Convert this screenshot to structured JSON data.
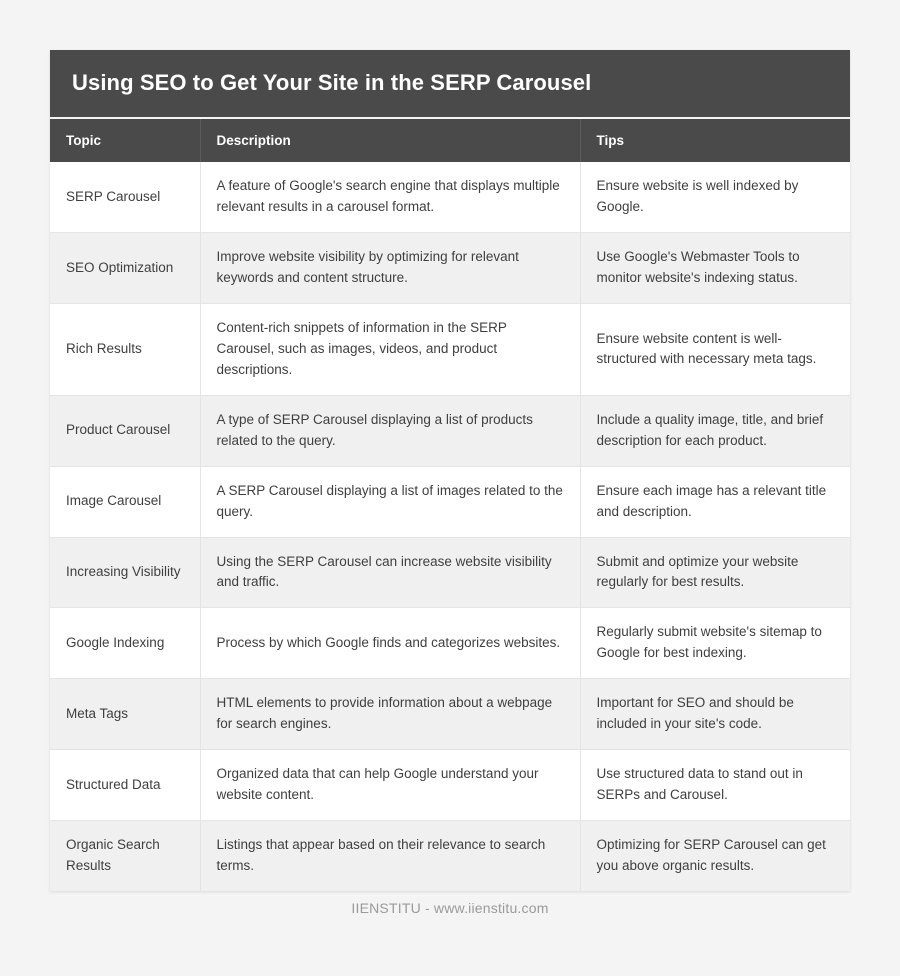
{
  "page": {
    "background_color": "#f4f4f4"
  },
  "card": {
    "title": "Using SEO to Get Your Site in the SERP Carousel",
    "header_color": "#4a4a4a",
    "row_alt_color": "#f0f0f0",
    "text_color": "#3f3f3f"
  },
  "table": {
    "columns": [
      "Topic",
      "Description",
      "Tips"
    ],
    "rows": [
      {
        "topic": "SERP Carousel",
        "description": "A feature of Google's search engine that displays multiple relevant results in a carousel format.",
        "tips": "Ensure website is well indexed by Google."
      },
      {
        "topic": "SEO Optimization",
        "description": "Improve website visibility by optimizing for relevant keywords and content structure.",
        "tips": "Use Google's Webmaster Tools to monitor website's indexing status."
      },
      {
        "topic": "Rich Results",
        "description": "Content-rich snippets of information in the SERP Carousel, such as images, videos, and product descriptions.",
        "tips": "Ensure website content is well-structured with necessary meta tags."
      },
      {
        "topic": "Product Carousel",
        "description": "A type of SERP Carousel displaying a list of products related to the query.",
        "tips": "Include a quality image, title, and brief description for each product."
      },
      {
        "topic": "Image Carousel",
        "description": "A SERP Carousel displaying a list of images related to the query.",
        "tips": "Ensure each image has a relevant title and description."
      },
      {
        "topic": "Increasing Visibility",
        "description": "Using the SERP Carousel can increase website visibility and traffic.",
        "tips": "Submit and optimize your website regularly for best results."
      },
      {
        "topic": "Google Indexing",
        "description": "Process by which Google finds and categorizes websites.",
        "tips": "Regularly submit website's sitemap to Google for best indexing."
      },
      {
        "topic": "Meta Tags",
        "description": "HTML elements to provide information about a webpage for search engines.",
        "tips": "Important for SEO and should be included in your site's code."
      },
      {
        "topic": "Structured Data",
        "description": "Organized data that can help Google understand your website content.",
        "tips": "Use structured data to stand out in SERPs and Carousel."
      },
      {
        "topic": "Organic Search Results",
        "description": "Listings that appear based on their relevance to search terms.",
        "tips": "Optimizing for SERP Carousel can get you above organic results."
      }
    ]
  },
  "footer": {
    "text": "IIENSTITU - www.iienstitu.com"
  }
}
